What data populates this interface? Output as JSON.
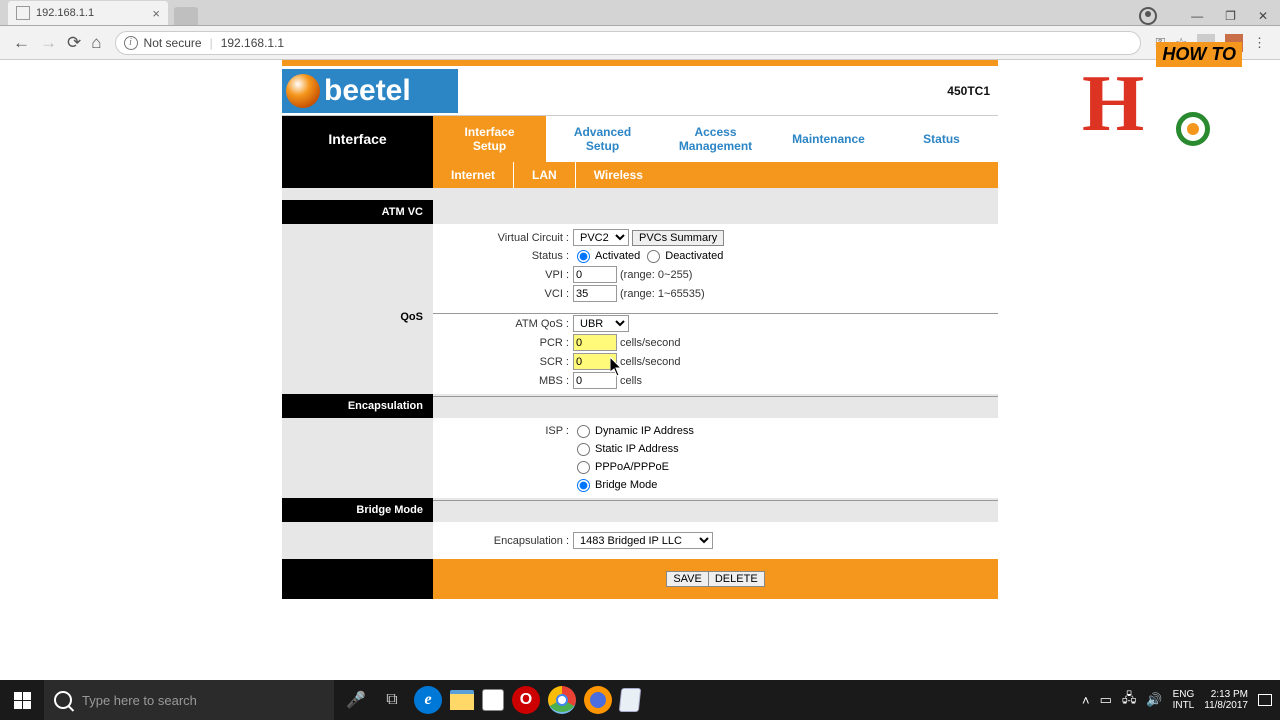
{
  "browser": {
    "tab_title": "192.168.1.1",
    "security_label": "Not secure",
    "url": "192.168.1.1"
  },
  "watermark": {
    "label": "HOW TO"
  },
  "brand": {
    "name": "beetel",
    "model": "450TC1"
  },
  "nav": {
    "left": "Interface",
    "items": [
      "Interface Setup",
      "Advanced Setup",
      "Access Management",
      "Maintenance",
      "Status"
    ],
    "sub": [
      "Internet",
      "LAN",
      "Wireless"
    ]
  },
  "sections": {
    "atm": {
      "title": "ATM VC",
      "vc_label": "Virtual Circuit :",
      "vc_value": "PVC2",
      "pvcs_button": "PVCs Summary",
      "status_label": "Status :",
      "status_activated": "Activated",
      "status_deactivated": "Deactivated",
      "vpi_label": "VPI :",
      "vpi_value": "0",
      "vpi_range": "(range: 0~255)",
      "vci_label": "VCI :",
      "vci_value": "35",
      "vci_range": "(range: 1~65535)"
    },
    "qos": {
      "title": "QoS",
      "atmqos_label": "ATM QoS :",
      "atmqos_value": "UBR",
      "pcr_label": "PCR :",
      "pcr_value": "0",
      "pcr_unit": "cells/second",
      "scr_label": "SCR :",
      "scr_value": "0",
      "scr_unit": "cells/second",
      "mbs_label": "MBS :",
      "mbs_value": "0",
      "mbs_unit": "cells"
    },
    "encap": {
      "title": "Encapsulation",
      "isp_label": "ISP :",
      "opt_dynamic": "Dynamic IP Address",
      "opt_static": "Static IP Address",
      "opt_pppoe": "PPPoA/PPPoE",
      "opt_bridge": "Bridge Mode"
    },
    "bridge": {
      "title": "Bridge Mode",
      "encap_label": "Encapsulation :",
      "encap_value": "1483 Bridged IP LLC"
    },
    "buttons": {
      "save": "SAVE",
      "delete": "DELETE"
    }
  },
  "taskbar": {
    "search_placeholder": "Type here to search",
    "lang1": "ENG",
    "lang2": "INTL",
    "time": "2:13 PM",
    "date": "11/8/2017"
  }
}
